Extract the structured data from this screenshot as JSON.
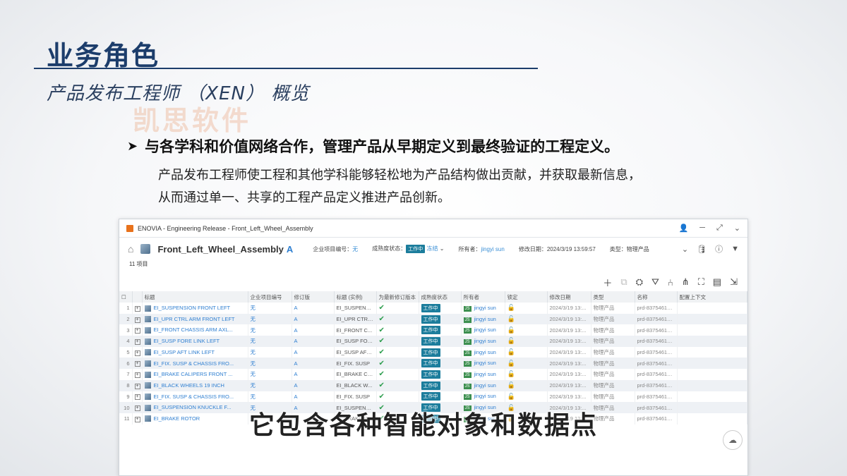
{
  "slide": {
    "title": "业务角色",
    "subtitle": "产品发布工程师 （XEN） 概览",
    "watermark": "凯思软件",
    "bullet": "与各学科和价值网络合作，管理产品从早期定义到最终验证的工程定义。",
    "desc_line1": "产品发布工程师使工程和其他学科能够轻松地为产品结构做出贡献，并获取最新信息，",
    "desc_line2": "从而通过单一、共享的工程产品定义推进产品创新。",
    "caption": "它包含各种智能对象和数据点"
  },
  "app": {
    "window_title": "ENOVIA - Engineering Release - Front_Left_Wheel_Assembly",
    "object_name": "Front_Left_Wheel_Assembly",
    "object_rev": "A",
    "meta": {
      "enterprise_label": "企业项目编号：",
      "enterprise_value": "无",
      "maturity_label": "成熟度状态：",
      "maturity_value": "工作中",
      "frozen": "冻结",
      "owner_label": "所有者：",
      "owner_value": "jingyi sun",
      "modified_label": "修改日期：",
      "modified_value": "2024/3/19 13:59:57",
      "type_label": "类型：",
      "type_value": "物理产品"
    },
    "item_count": "11 项目",
    "columns": [
      "标题",
      "企业项目编号",
      "修订版",
      "标题 (实例)",
      "为最新修订版本",
      "成熟度状态",
      "所有者",
      "锁定",
      "修改日期",
      "类型",
      "名称",
      "配置上下文"
    ],
    "rows": [
      {
        "n": "1",
        "title": "EI_SUSPENSION FRONT LEFT",
        "ent": "无",
        "rev": "A",
        "inst": "EI_SUSPENSI...",
        "state": "工作中",
        "owner": "jingyi  sun",
        "date": "2024/3/19 13:...",
        "type": "物理产品",
        "name": "prd-83754613-..."
      },
      {
        "n": "2",
        "title": "EI_UPR CTRL ARM FRONT LEFT",
        "ent": "无",
        "rev": "A",
        "inst": "EI_UPR CTRL...",
        "state": "工作中",
        "owner": "jingyi  sun",
        "date": "2024/3/19 13:...",
        "type": "物理产品",
        "name": "prd-83754613-..."
      },
      {
        "n": "3",
        "title": "EI_FRONT CHASSIS ARM AXL...",
        "ent": "无",
        "rev": "A",
        "inst": "EI_FRONT C...",
        "state": "工作中",
        "owner": "jingyi  sun",
        "date": "2024/3/19 13:...",
        "type": "物理产品",
        "name": "prd-83754613-..."
      },
      {
        "n": "4",
        "title": "EI_SUSP FORE LINK LEFT",
        "ent": "无",
        "rev": "A",
        "inst": "EI_SUSP FOR...",
        "state": "工作中",
        "owner": "jingyi  sun",
        "date": "2024/3/19 13:...",
        "type": "物理产品",
        "name": "prd-83754613-..."
      },
      {
        "n": "5",
        "title": "EI_SUSP AFT LINK LEFT",
        "ent": "无",
        "rev": "A",
        "inst": "EI_SUSP AFT ...",
        "state": "工作中",
        "owner": "jingyi  sun",
        "date": "2024/3/19 13:...",
        "type": "物理产品",
        "name": "prd-83754613-..."
      },
      {
        "n": "6",
        "title": "EI_FIX. SUSP & CHASSIS FRO...",
        "ent": "无",
        "rev": "A",
        "inst": "EI_FIX. SUSP",
        "state": "工作中",
        "owner": "jingyi  sun",
        "date": "2024/3/19 13:...",
        "type": "物理产品",
        "name": "prd-83754613-..."
      },
      {
        "n": "7",
        "title": "EI_BRAKE CALIPERS FRONT ...",
        "ent": "无",
        "rev": "A",
        "inst": "EI_BRAKE CA...",
        "state": "工作中",
        "owner": "jingyi  sun",
        "date": "2024/3/19 13:...",
        "type": "物理产品",
        "name": "prd-83754613-..."
      },
      {
        "n": "8",
        "title": "EI_BLACK WHEELS 19 INCH",
        "ent": "无",
        "rev": "A",
        "inst": "EI_BLACK W...",
        "state": "工作中",
        "owner": "jingyi  sun",
        "date": "2024/3/19 13:...",
        "type": "物理产品",
        "name": "prd-83754613-..."
      },
      {
        "n": "9",
        "title": "EI_FIX. SUSP & CHASSIS FRO...",
        "ent": "无",
        "rev": "A",
        "inst": "EI_FIX. SUSP",
        "state": "工作中",
        "owner": "jingyi  sun",
        "date": "2024/3/19 13:...",
        "type": "物理产品",
        "name": "prd-83754613-..."
      },
      {
        "n": "10",
        "title": "EI_SUSPENSION KNUCKLE F...",
        "ent": "无",
        "rev": "A",
        "inst": "EI_SUSPENSI...",
        "state": "工作中",
        "owner": "jingyi  sun",
        "date": "2024/3/19 13:...",
        "type": "物理产品",
        "name": "prd-83754613-..."
      },
      {
        "n": "11",
        "title": "EI_BRAKE ROTOR",
        "ent": "无",
        "rev": "A",
        "inst": "EI_BRAKE R...",
        "state": "工作中",
        "owner": "jingyi  sun",
        "date": "2024/3/19 13:...",
        "type": "物理产品",
        "name": "prd-83754613-..."
      }
    ]
  }
}
